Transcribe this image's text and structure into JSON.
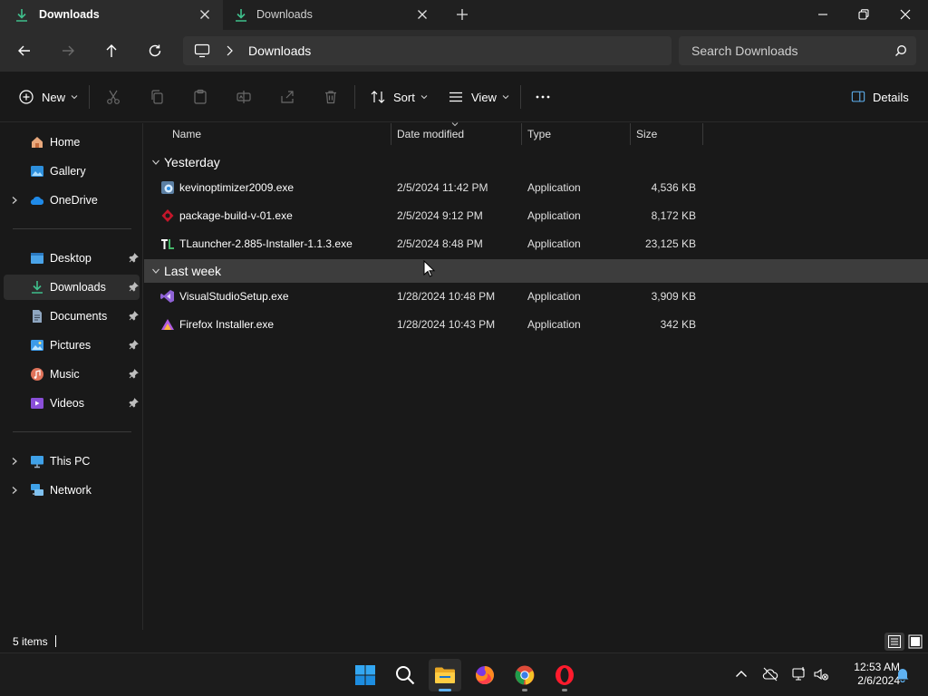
{
  "window": {
    "tabs": [
      {
        "label": "Downloads",
        "active": true
      },
      {
        "label": "Downloads",
        "active": false
      }
    ]
  },
  "navigation": {
    "breadcrumb": [
      "Downloads"
    ],
    "search_placeholder": "Search Downloads"
  },
  "toolbar": {
    "new_label": "New",
    "sort_label": "Sort",
    "view_label": "View",
    "details_label": "Details"
  },
  "sidebar": {
    "items": [
      {
        "label": "Home",
        "icon": "home-icon"
      },
      {
        "label": "Gallery",
        "icon": "gallery-icon"
      },
      {
        "label": "OneDrive",
        "icon": "onedrive-icon"
      },
      {
        "label": "Desktop",
        "icon": "desktop-icon"
      },
      {
        "label": "Downloads",
        "icon": "downloads-icon",
        "selected": true
      },
      {
        "label": "Documents",
        "icon": "documents-icon"
      },
      {
        "label": "Pictures",
        "icon": "pictures-icon"
      },
      {
        "label": "Music",
        "icon": "music-icon"
      },
      {
        "label": "Videos",
        "icon": "videos-icon"
      },
      {
        "label": "This PC",
        "icon": "this-pc-icon"
      },
      {
        "label": "Network",
        "icon": "network-icon"
      }
    ]
  },
  "file_list": {
    "columns": [
      "Name",
      "Date modified",
      "Type",
      "Size"
    ],
    "groups": [
      {
        "label": "Yesterday",
        "files": [
          {
            "name": "kevinoptimizer2009.exe",
            "date": "2/5/2024 11:42 PM",
            "type": "Application",
            "size": "4,536 KB"
          },
          {
            "name": "package-build-v-01.exe",
            "date": "2/5/2024 9:12 PM",
            "type": "Application",
            "size": "8,172 KB"
          },
          {
            "name": "TLauncher-2.885-Installer-1.1.3.exe",
            "date": "2/5/2024 8:48 PM",
            "type": "Application",
            "size": "23,125 KB"
          }
        ]
      },
      {
        "label": "Last week",
        "files": [
          {
            "name": "VisualStudioSetup.exe",
            "date": "1/28/2024 10:48 PM",
            "type": "Application",
            "size": "3,909 KB"
          },
          {
            "name": "Firefox Installer.exe",
            "date": "1/28/2024 10:43 PM",
            "type": "Application",
            "size": "342 KB"
          }
        ]
      }
    ]
  },
  "status_bar": {
    "item_count": "5 items"
  },
  "taskbar": {
    "time": "12:53 AM",
    "date": "2/6/2024"
  },
  "colors": {
    "accent": "#5fb2f2",
    "downloads_green": "#3fbf8c",
    "background": "#191919"
  }
}
